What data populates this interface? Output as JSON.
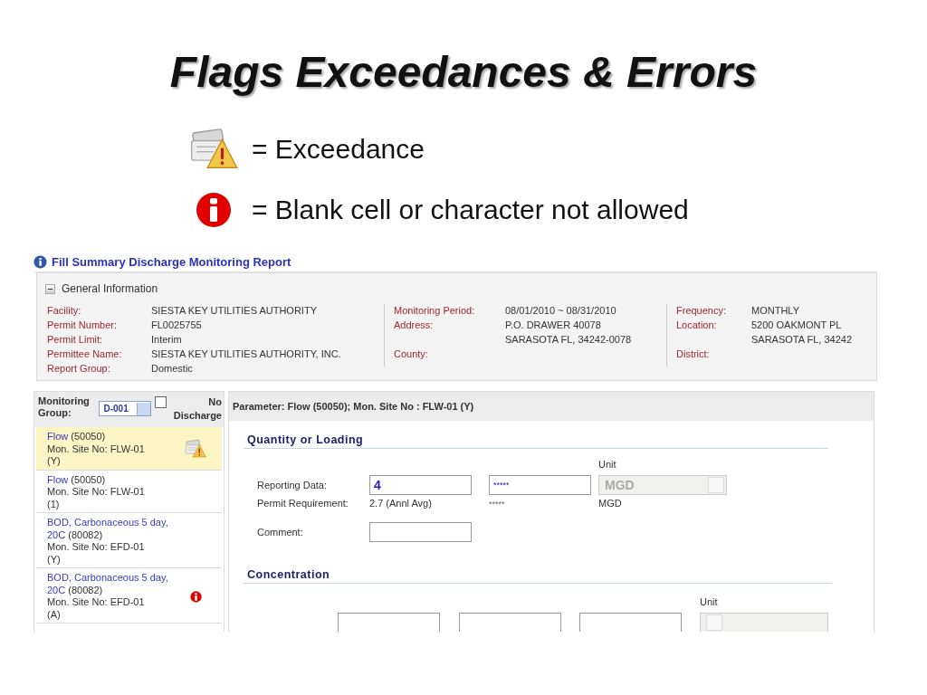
{
  "title": "Flags Exceedances & Errors",
  "legend": [
    {
      "kind": "exceedance",
      "text": "= Exceedance"
    },
    {
      "kind": "error",
      "text": "= Blank cell or character not allowed"
    }
  ],
  "report": {
    "title": "Fill Summary Discharge Monitoring Report",
    "general_info": {
      "heading": "General Information",
      "expanded": true,
      "columns": [
        [
          {
            "label": "Facility:",
            "lines": [
              "SIESTA KEY UTILITIES AUTHORITY"
            ]
          },
          {
            "label": "Permit Number:",
            "lines": [
              "FL0025755"
            ]
          },
          {
            "label": "Permit Limit:",
            "lines": [
              "Interim"
            ]
          },
          {
            "label": "Permittee Name:",
            "lines": [
              "SIESTA KEY UTILITIES AUTHORITY, INC."
            ]
          },
          {
            "label": "Report Group:",
            "lines": [
              "Domestic"
            ]
          }
        ],
        [
          {
            "label": "Monitoring Period:",
            "lines": [
              "08/01/2010 ~ 08/31/2010"
            ]
          },
          {
            "label": "Address:",
            "lines": [
              "P.O. DRAWER 40078",
              "SARASOTA FL, 34242-0078"
            ]
          },
          {
            "label": "County:"
          }
        ],
        [
          {
            "label": "Frequency:",
            "lines": [
              "MONTHLY"
            ]
          },
          {
            "label": "Location:",
            "lines": [
              "5200 OAKMONT PL",
              "SARASOTA FL, 34242"
            ]
          },
          {
            "label": "District:"
          }
        ]
      ]
    },
    "sidebar": {
      "group_label": "Monitoring Group:",
      "group_value": "D-001",
      "no_discharge": {
        "label": "No Discharge",
        "checked": false
      },
      "items": [
        {
          "name": "Flow",
          "code": "(50050)",
          "site": "Mon. Site No: FLW-01",
          "suffix": "(Y)",
          "selected": true,
          "kind": "exceedance"
        },
        {
          "name": "Flow",
          "code": "(50050)",
          "site": "Mon. Site No: FLW-01",
          "suffix": "(1)",
          "selected": false,
          "kind": "plain"
        },
        {
          "name": "BOD, Carbonaceous 5 day, 20C",
          "code": "(80082)",
          "site": "Mon. Site No: EFD-01",
          "suffix": "(Y)",
          "selected": false,
          "kind": "plain"
        },
        {
          "name": "BOD, Carbonaceous 5 day, 20C",
          "code": "(80082)",
          "site": "Mon. Site No: EFD-01",
          "suffix": "(A)",
          "selected": false,
          "kind": "error"
        }
      ]
    },
    "parameter": {
      "header": "Parameter: Flow (50050); Mon. Site No : FLW-01 (Y)",
      "quantity": {
        "heading": "Quantity or Loading",
        "unit_label": "Unit",
        "reporting_label": "Reporting Data:",
        "value_1": "4",
        "value_2": "*****",
        "unit": {
          "value": "MGD",
          "disabled": true
        },
        "requirement_label": "Permit Requirement:",
        "requirement_1": "2.7 (Annl Avg)",
        "requirement_2": "*****",
        "requirement_unit": "MGD",
        "comment_label": "Comment:"
      },
      "concentration": {
        "heading": "Concentration",
        "unit_label": "Unit",
        "unit": {
          "disabled": true
        }
      }
    }
  }
}
